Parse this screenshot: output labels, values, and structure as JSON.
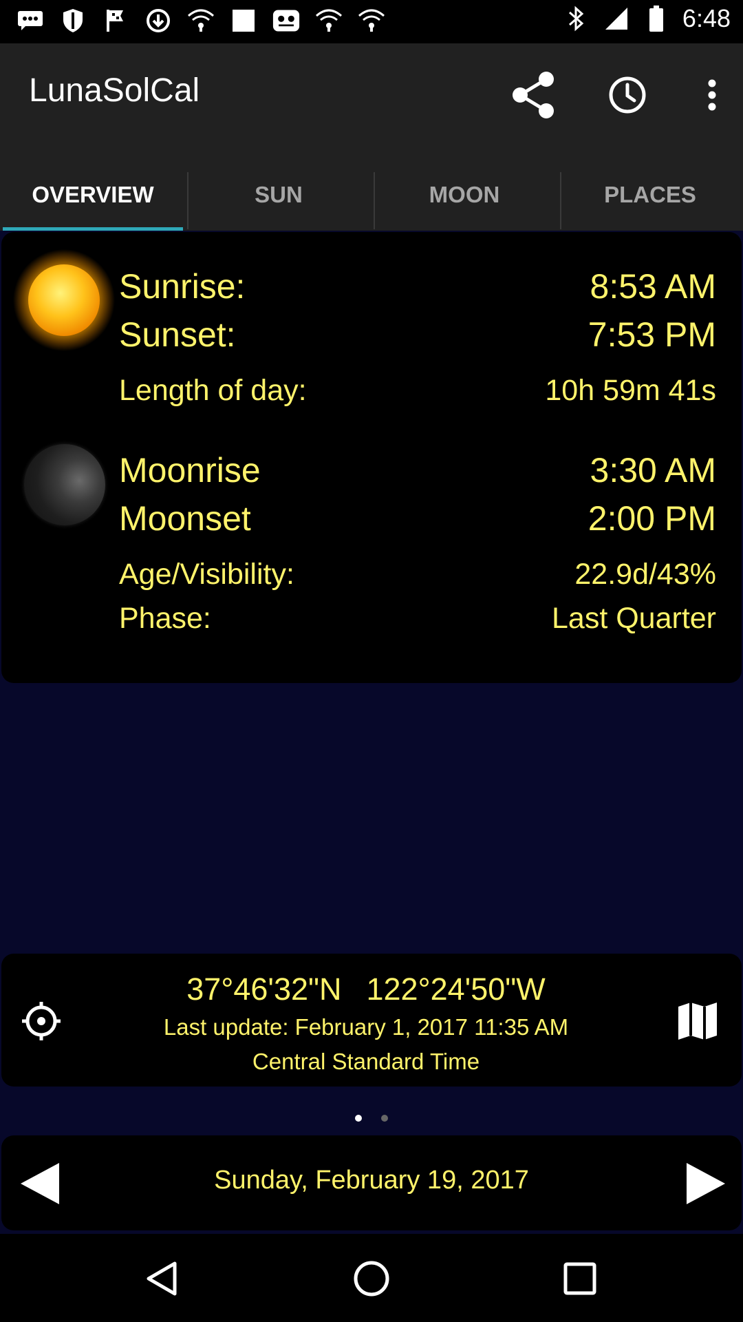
{
  "status_bar": {
    "time": "6:48",
    "icons": [
      "chat-icon",
      "shield-icon",
      "flag-icon",
      "download-icon",
      "wifi-icon",
      "wifi-icon",
      "stop-icon",
      "voicemail-icon",
      "wifi-icon",
      "wifi-icon",
      "bluetooth-icon",
      "battery-icon"
    ]
  },
  "app_bar": {
    "title": "LunaSolCal",
    "actions": [
      "share-icon",
      "clock-icon",
      "more-vert-icon"
    ]
  },
  "tabs": [
    {
      "label": "OVERVIEW",
      "active": true
    },
    {
      "label": "SUN",
      "active": false
    },
    {
      "label": "MOON",
      "active": false
    },
    {
      "label": "PLACES",
      "active": false
    }
  ],
  "sun": {
    "sunrise_label": "Sunrise:",
    "sunrise_value": "8:53 AM",
    "sunset_label": "Sunset:",
    "sunset_value": "7:53 PM",
    "length_label": "Length of day:",
    "length_value": "10h 59m 41s"
  },
  "moon": {
    "moonrise_label": "Moonrise",
    "moonrise_value": "3:30 AM",
    "moonset_label": "Moonset",
    "moonset_value": "2:00 PM",
    "age_label": "Age/Visibility:",
    "age_value": "22.9d/43%",
    "phase_label": "Phase:",
    "phase_value": "Last Quarter"
  },
  "location": {
    "latitude": "37°46'32\"N",
    "longitude": "122°24'50\"W",
    "last_update": "Last update: February 1, 2017 11:35 AM",
    "timezone": "Central Standard Time"
  },
  "pager": {
    "pages": 2,
    "current": 1
  },
  "date_nav": {
    "date": "Sunday, February 19, 2017"
  },
  "colors": {
    "accent": "#fff36b",
    "tab_indicator": "#2fa8b8",
    "background": "#07082a",
    "app_bar": "#212121"
  }
}
